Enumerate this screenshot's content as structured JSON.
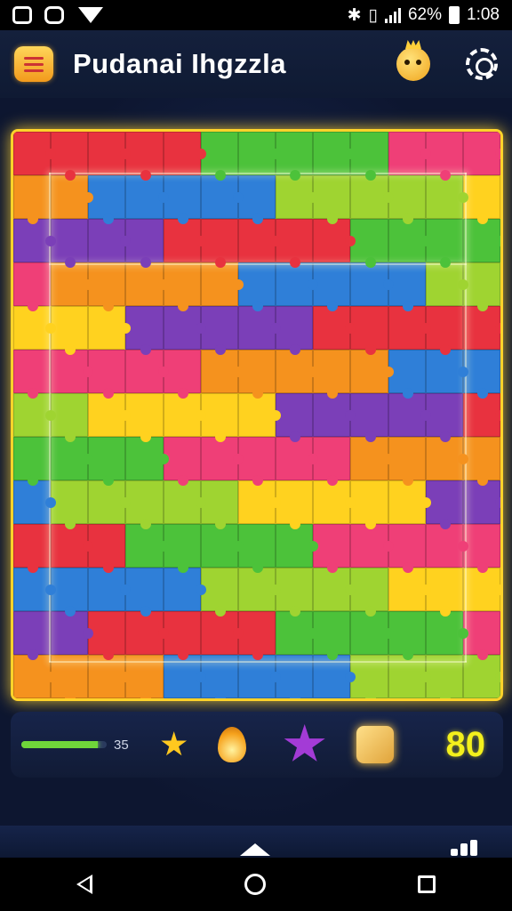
{
  "status_bar": {
    "battery_percent": "62%",
    "time": "1:08",
    "left_icons": [
      "app-icon",
      "messenger-icon",
      "wifi-icon"
    ]
  },
  "header": {
    "title": "Pudanai Ihgzzla",
    "menu_icon": "menu-icon",
    "mascot_icon": "mascot-icon",
    "settings_icon": "gear-icon"
  },
  "board": {
    "rows": 13,
    "cols": 13,
    "border_color": "#ffd32a",
    "palette": [
      "c-red",
      "c-org",
      "c-yel",
      "c-grn",
      "c-blu",
      "c-pur",
      "c-pnk",
      "c-lim"
    ]
  },
  "footer": {
    "progress_fraction": 0.9,
    "progress_label": "35",
    "icons": [
      "star-icon",
      "flame-icon",
      "purple-star-icon",
      "crate-icon"
    ],
    "score": "80"
  },
  "nav": {
    "back_icon": "back-icon",
    "home_icon": "home-icon",
    "recents_icon": "recents-icon"
  },
  "colors": {
    "accent_yellow": "#ffd32a",
    "score_yellow": "#f3f01c",
    "progress_green": "#6fd63a",
    "bg_navy": "#0b1224"
  }
}
